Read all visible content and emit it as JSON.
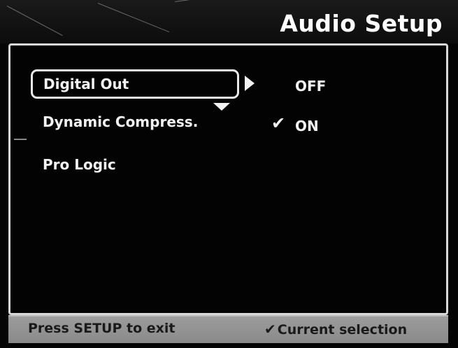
{
  "header": {
    "title": "Audio Setup"
  },
  "menu": {
    "items": [
      {
        "label": "Digital Out",
        "value": "OFF",
        "selected": true
      },
      {
        "label": "Dynamic Compress.",
        "value": "ON",
        "current": true
      },
      {
        "label": "Pro Logic"
      }
    ],
    "check_glyph": "✔"
  },
  "footer": {
    "hint": "Press SETUP to exit",
    "legend_glyph": "✔",
    "legend_label": "Current selection"
  }
}
